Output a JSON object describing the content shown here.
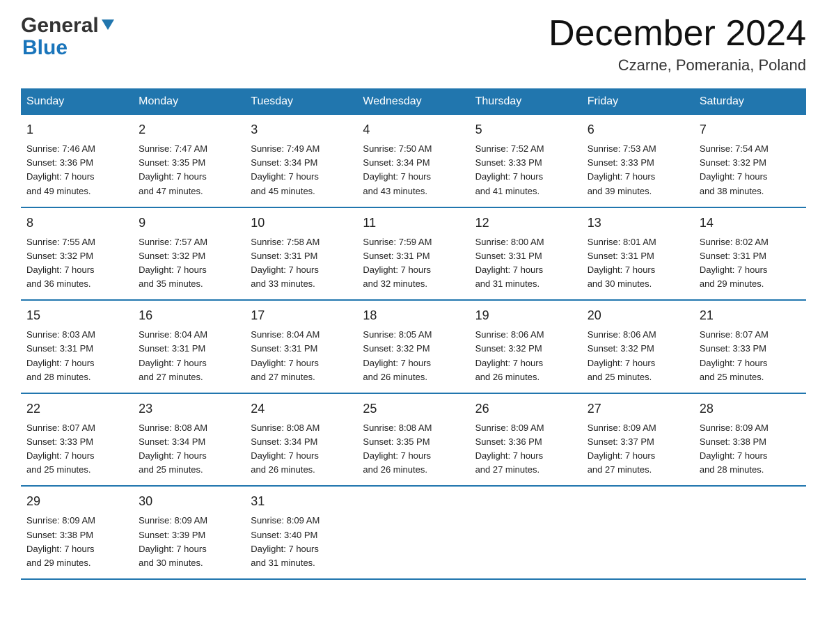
{
  "header": {
    "title": "December 2024",
    "subtitle": "Czarne, Pomerania, Poland",
    "logo_general": "General",
    "logo_blue": "Blue"
  },
  "columns": [
    "Sunday",
    "Monday",
    "Tuesday",
    "Wednesday",
    "Thursday",
    "Friday",
    "Saturday"
  ],
  "weeks": [
    [
      {
        "day": "1",
        "sunrise": "7:46 AM",
        "sunset": "3:36 PM",
        "daylight": "7 hours and 49 minutes."
      },
      {
        "day": "2",
        "sunrise": "7:47 AM",
        "sunset": "3:35 PM",
        "daylight": "7 hours and 47 minutes."
      },
      {
        "day": "3",
        "sunrise": "7:49 AM",
        "sunset": "3:34 PM",
        "daylight": "7 hours and 45 minutes."
      },
      {
        "day": "4",
        "sunrise": "7:50 AM",
        "sunset": "3:34 PM",
        "daylight": "7 hours and 43 minutes."
      },
      {
        "day": "5",
        "sunrise": "7:52 AM",
        "sunset": "3:33 PM",
        "daylight": "7 hours and 41 minutes."
      },
      {
        "day": "6",
        "sunrise": "7:53 AM",
        "sunset": "3:33 PM",
        "daylight": "7 hours and 39 minutes."
      },
      {
        "day": "7",
        "sunrise": "7:54 AM",
        "sunset": "3:32 PM",
        "daylight": "7 hours and 38 minutes."
      }
    ],
    [
      {
        "day": "8",
        "sunrise": "7:55 AM",
        "sunset": "3:32 PM",
        "daylight": "7 hours and 36 minutes."
      },
      {
        "day": "9",
        "sunrise": "7:57 AM",
        "sunset": "3:32 PM",
        "daylight": "7 hours and 35 minutes."
      },
      {
        "day": "10",
        "sunrise": "7:58 AM",
        "sunset": "3:31 PM",
        "daylight": "7 hours and 33 minutes."
      },
      {
        "day": "11",
        "sunrise": "7:59 AM",
        "sunset": "3:31 PM",
        "daylight": "7 hours and 32 minutes."
      },
      {
        "day": "12",
        "sunrise": "8:00 AM",
        "sunset": "3:31 PM",
        "daylight": "7 hours and 31 minutes."
      },
      {
        "day": "13",
        "sunrise": "8:01 AM",
        "sunset": "3:31 PM",
        "daylight": "7 hours and 30 minutes."
      },
      {
        "day": "14",
        "sunrise": "8:02 AM",
        "sunset": "3:31 PM",
        "daylight": "7 hours and 29 minutes."
      }
    ],
    [
      {
        "day": "15",
        "sunrise": "8:03 AM",
        "sunset": "3:31 PM",
        "daylight": "7 hours and 28 minutes."
      },
      {
        "day": "16",
        "sunrise": "8:04 AM",
        "sunset": "3:31 PM",
        "daylight": "7 hours and 27 minutes."
      },
      {
        "day": "17",
        "sunrise": "8:04 AM",
        "sunset": "3:31 PM",
        "daylight": "7 hours and 27 minutes."
      },
      {
        "day": "18",
        "sunrise": "8:05 AM",
        "sunset": "3:32 PM",
        "daylight": "7 hours and 26 minutes."
      },
      {
        "day": "19",
        "sunrise": "8:06 AM",
        "sunset": "3:32 PM",
        "daylight": "7 hours and 26 minutes."
      },
      {
        "day": "20",
        "sunrise": "8:06 AM",
        "sunset": "3:32 PM",
        "daylight": "7 hours and 25 minutes."
      },
      {
        "day": "21",
        "sunrise": "8:07 AM",
        "sunset": "3:33 PM",
        "daylight": "7 hours and 25 minutes."
      }
    ],
    [
      {
        "day": "22",
        "sunrise": "8:07 AM",
        "sunset": "3:33 PM",
        "daylight": "7 hours and 25 minutes."
      },
      {
        "day": "23",
        "sunrise": "8:08 AM",
        "sunset": "3:34 PM",
        "daylight": "7 hours and 25 minutes."
      },
      {
        "day": "24",
        "sunrise": "8:08 AM",
        "sunset": "3:34 PM",
        "daylight": "7 hours and 26 minutes."
      },
      {
        "day": "25",
        "sunrise": "8:08 AM",
        "sunset": "3:35 PM",
        "daylight": "7 hours and 26 minutes."
      },
      {
        "day": "26",
        "sunrise": "8:09 AM",
        "sunset": "3:36 PM",
        "daylight": "7 hours and 27 minutes."
      },
      {
        "day": "27",
        "sunrise": "8:09 AM",
        "sunset": "3:37 PM",
        "daylight": "7 hours and 27 minutes."
      },
      {
        "day": "28",
        "sunrise": "8:09 AM",
        "sunset": "3:38 PM",
        "daylight": "7 hours and 28 minutes."
      }
    ],
    [
      {
        "day": "29",
        "sunrise": "8:09 AM",
        "sunset": "3:38 PM",
        "daylight": "7 hours and 29 minutes."
      },
      {
        "day": "30",
        "sunrise": "8:09 AM",
        "sunset": "3:39 PM",
        "daylight": "7 hours and 30 minutes."
      },
      {
        "day": "31",
        "sunrise": "8:09 AM",
        "sunset": "3:40 PM",
        "daylight": "7 hours and 31 minutes."
      },
      {
        "day": "",
        "sunrise": "",
        "sunset": "",
        "daylight": ""
      },
      {
        "day": "",
        "sunrise": "",
        "sunset": "",
        "daylight": ""
      },
      {
        "day": "",
        "sunrise": "",
        "sunset": "",
        "daylight": ""
      },
      {
        "day": "",
        "sunrise": "",
        "sunset": "",
        "daylight": ""
      }
    ]
  ],
  "labels": {
    "sunrise": "Sunrise: ",
    "sunset": "Sunset: ",
    "daylight": "Daylight: "
  }
}
